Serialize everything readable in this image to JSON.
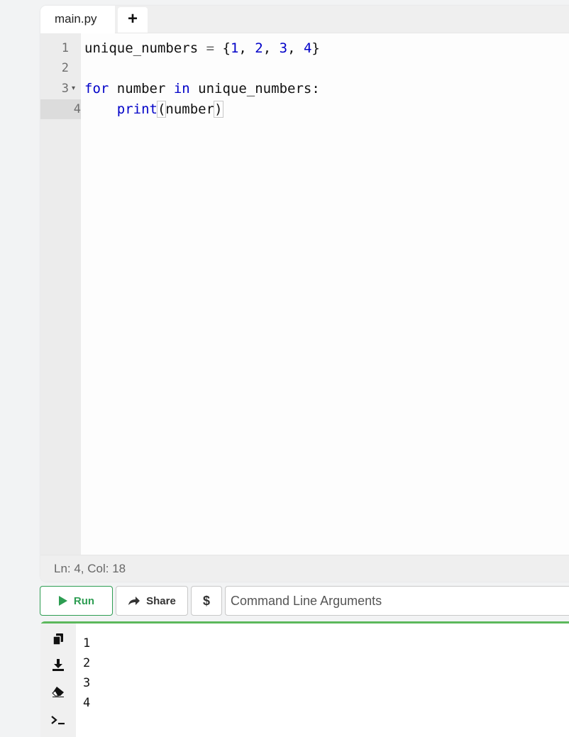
{
  "tabs": {
    "active": "main.py",
    "add": "+"
  },
  "editor": {
    "line_numbers": [
      "1",
      "2",
      "3",
      "4"
    ],
    "fold_arrow": "▾",
    "code": {
      "l1_var": "unique_numbers",
      "l1_eq": " = ",
      "l1_open": "{",
      "l1_n1": "1",
      "l1_n2": "2",
      "l1_n3": "3",
      "l1_n4": "4",
      "l1_sep": ", ",
      "l1_close": "}",
      "l3_for": "for",
      "l3_var": " number ",
      "l3_in": "in",
      "l3_rest": " unique_numbers:",
      "l4_indent": "    ",
      "l4_print": "print",
      "l4_open": "(",
      "l4_arg": "number",
      "l4_close": ")"
    }
  },
  "status": {
    "position": "Ln: 4,  Col: 18"
  },
  "toolbar": {
    "run_label": "Run",
    "share_label": "Share",
    "dollar_label": "$",
    "args_placeholder": "Command Line Arguments"
  },
  "output": {
    "lines": [
      "1",
      "2",
      "3",
      "4"
    ],
    "icons": [
      "copy-icon",
      "download-icon",
      "eraser-icon",
      "terminal-icon"
    ]
  },
  "colors": {
    "accent_green": "#2d9d52",
    "keyword_blue": "#0000c8",
    "output_border": "#5cb85c"
  }
}
